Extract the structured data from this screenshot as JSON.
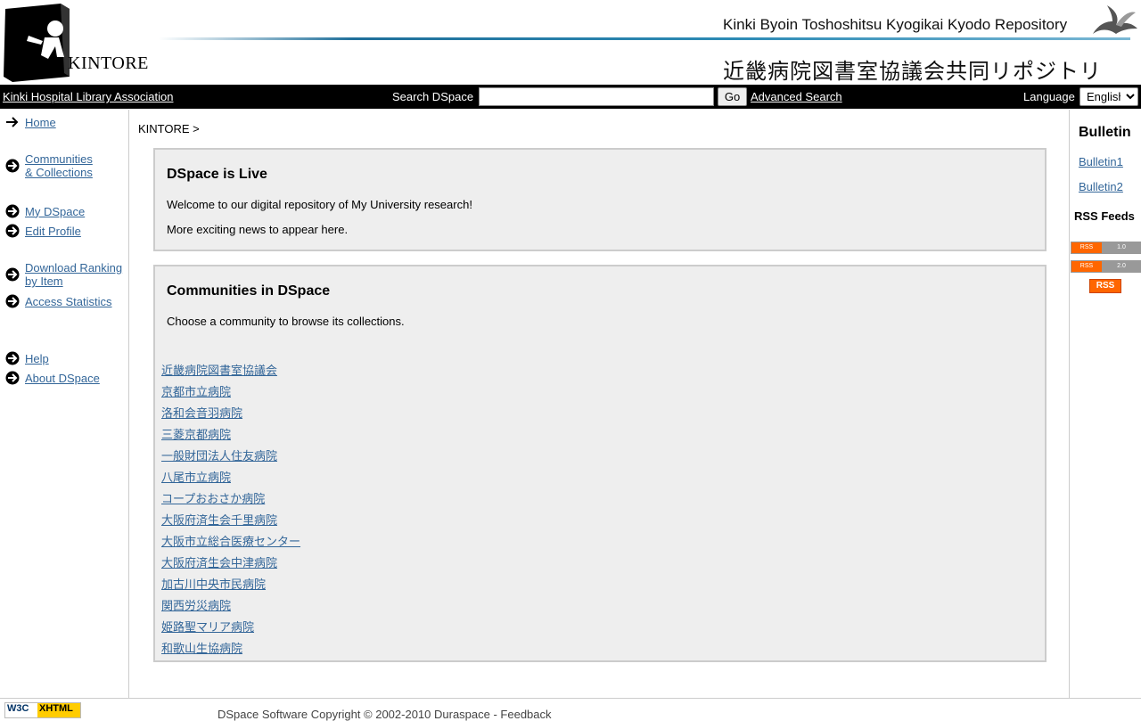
{
  "header": {
    "logo_text": "KINTORE",
    "title_en": "Kinki Byoin Toshoshitsu Kyogikai Kyodo Repository",
    "title_jp": "近畿病院図書室協議会共同リポジトリ"
  },
  "navbar": {
    "org_link": "Kinki Hospital Library Association",
    "search_label": "Search DSpace",
    "search_value": "",
    "go_label": "Go",
    "advanced_label": "Advanced Search",
    "language_label": "Language",
    "language_selected": "English"
  },
  "sidebar": {
    "items": [
      {
        "label": "Home"
      },
      {
        "label": "Communities",
        "label2": "& Collections"
      },
      {
        "label": "My DSpace"
      },
      {
        "label": "Edit Profile"
      },
      {
        "label": "Download Ranking",
        "label2": " by Item"
      },
      {
        "label": "Access Statistics"
      },
      {
        "label": "Help"
      },
      {
        "label": "About DSpace"
      }
    ]
  },
  "main": {
    "breadcrumb": "KINTORE >",
    "news": {
      "title": "DSpace is Live",
      "line1": "Welcome to our digital repository of My University research!",
      "line2": "More exciting news to appear here."
    },
    "communities": {
      "title": "Communities in DSpace",
      "subtitle": "Choose a community to browse its collections.",
      "list": [
        "近畿病院図書室協議会",
        "京都市立病院",
        "洛和会音羽病院",
        "三菱京都病院",
        "一般財団法人住友病院",
        "八尾市立病院",
        "コープおおさか病院",
        "大阪府済生会千里病院",
        "大阪市立総合医療センター",
        "大阪府済生会中津病院",
        "加古川中央市民病院",
        "関西労災病院",
        "姫路聖マリア病院",
        "和歌山生協病院"
      ]
    }
  },
  "rightbar": {
    "bulletin_title": "Bulletin",
    "bulletin1": "Bulletin1",
    "bulletin2": "Bulletin2",
    "rss_title": "RSS Feeds",
    "rss1_left": "RSS",
    "rss1_right": "1.0",
    "rss2_left": "RSS",
    "rss2_right": "2.0",
    "rss_big": "RSS"
  },
  "footer": {
    "w3c_left": "W3C",
    "w3c_right": "XHTML",
    "text": "DSpace Software Copyright © 2002-2010 Duraspace - Feedback"
  }
}
